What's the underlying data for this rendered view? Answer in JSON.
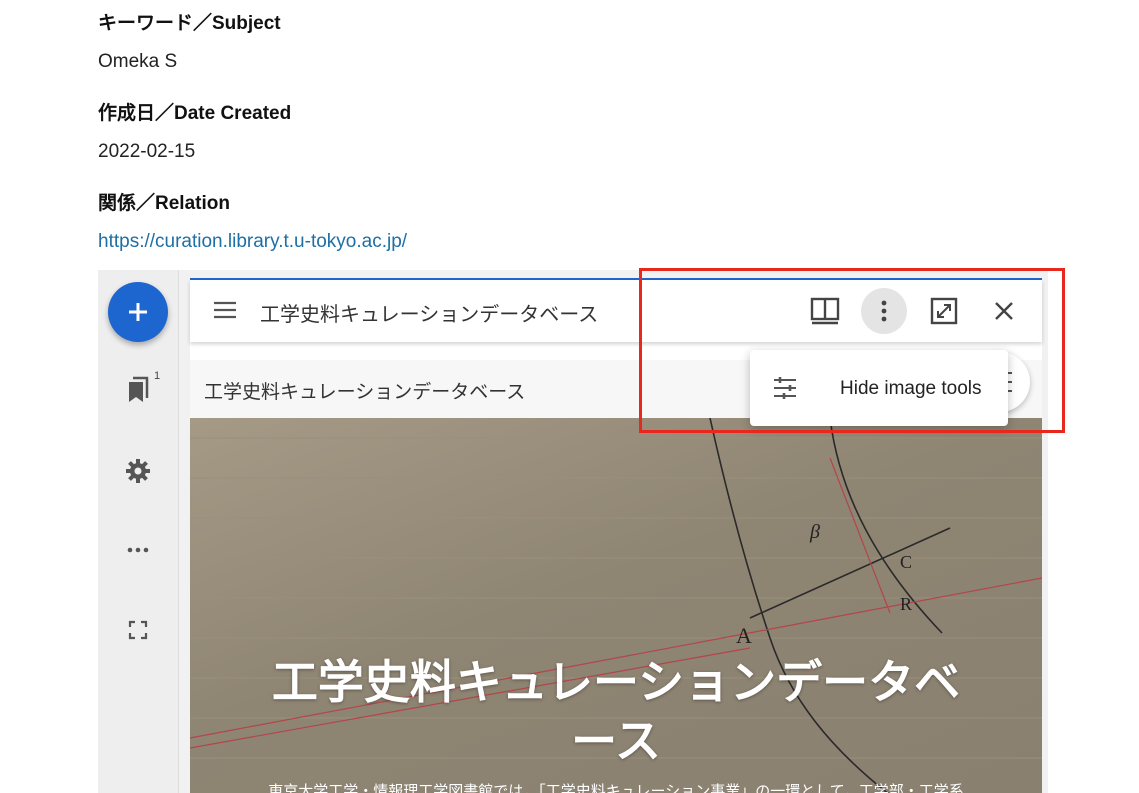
{
  "metadata": [
    {
      "label": "キーワード／Subject",
      "value": "Omeka S"
    },
    {
      "label": "作成日／Date Created",
      "value": "2022-02-15"
    },
    {
      "label": "関係／Relation",
      "value": "https://curation.library.t.u-tokyo.ac.jp/"
    }
  ],
  "viewer": {
    "sidebar": {
      "add_icon": "plus-icon",
      "bookmark_count": "1",
      "icons": [
        "bookmark-icon",
        "gear-icon",
        "more-horizontal-icon",
        "fullscreen-icon"
      ]
    },
    "window": {
      "title": "工学史料キュレーションデータベース",
      "toolbar_icons": [
        "book-view-icon",
        "more-vertical-icon",
        "maximize-icon",
        "close-icon"
      ],
      "subheader_title": "工学史料キュレーションデータベース",
      "menu": {
        "items": [
          {
            "icon": "sliders-icon",
            "label": "Hide image tools"
          }
        ]
      },
      "hero_title_line1": "工学史料キュレーションデータベ",
      "hero_title_line2": "ース",
      "hero_subtitle": "東京大学工学・情報理工学図書館では，「工学史料キュレーション事業」の一環として，工学部・工学系"
    }
  },
  "colors": {
    "accent": "#1e66cf",
    "link": "#1d6fa5",
    "highlight": "#e8281d"
  }
}
